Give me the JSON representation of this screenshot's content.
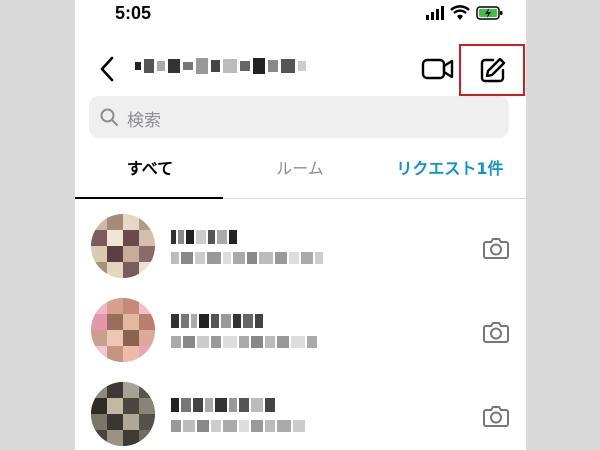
{
  "status_bar": {
    "time": "5:05"
  },
  "search": {
    "placeholder": "検索"
  },
  "tabs": [
    {
      "label": "すべて",
      "active": true
    },
    {
      "label": "ルーム",
      "active": false
    },
    {
      "label": "リクエスト1件",
      "active": false
    }
  ],
  "colors": {
    "accent": "#0f91d6",
    "highlight_box": "#d51a1a",
    "battery": "#3ec244"
  },
  "icons": [
    "back-icon",
    "video-call-icon",
    "compose-icon",
    "search-icon",
    "camera-icon"
  ],
  "chat_rows_count": 3
}
